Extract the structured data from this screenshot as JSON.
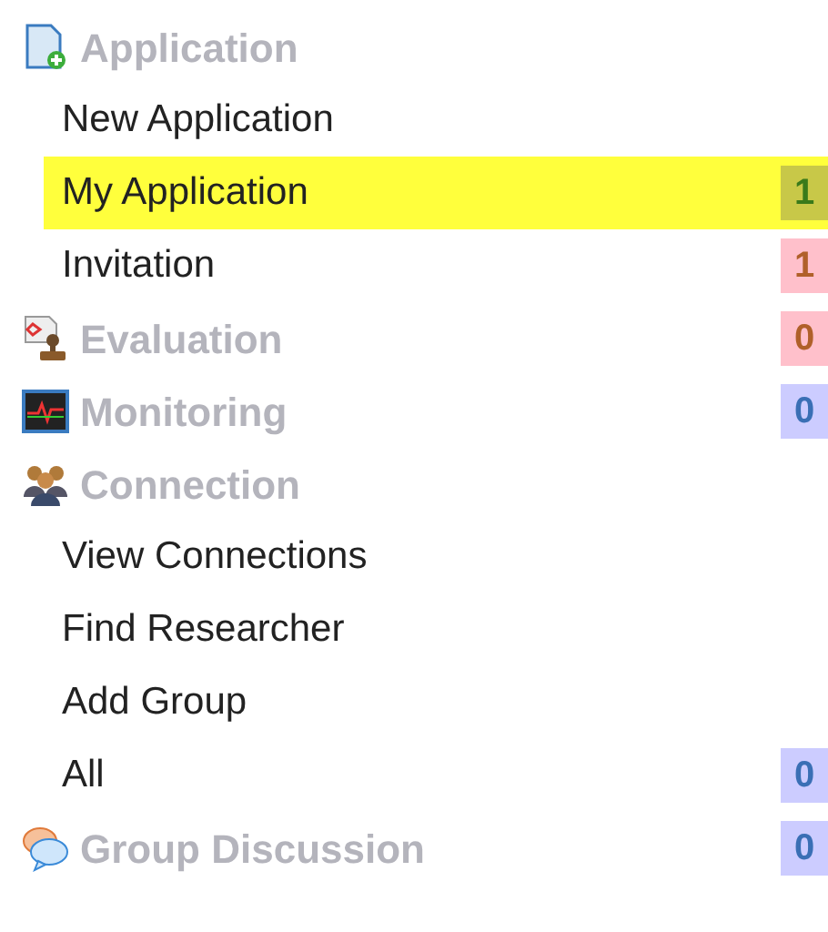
{
  "sections": [
    {
      "title": "Application",
      "items": [
        {
          "label": "New Application",
          "selected": false
        },
        {
          "label": "My Application",
          "selected": true,
          "count": "1",
          "color": "#c8c848"
        },
        {
          "label": "Invitation",
          "selected": false,
          "count": "1",
          "color": "#ffc0cb"
        }
      ]
    },
    {
      "title": "Evaluation",
      "count": "0",
      "color": "#ffc0cb"
    },
    {
      "title": "Monitoring",
      "count": "0",
      "color": "#ccccff"
    },
    {
      "title": "Connection",
      "items": [
        {
          "label": "View Connections",
          "selected": false
        },
        {
          "label": "Find Researcher",
          "selected": false
        },
        {
          "label": "Add Group",
          "selected": false
        },
        {
          "label": "All",
          "selected": false,
          "count": "0",
          "color": "#ccccff"
        }
      ]
    },
    {
      "title": "Group Discussion",
      "count": "0",
      "color": "#ccccff"
    }
  ]
}
